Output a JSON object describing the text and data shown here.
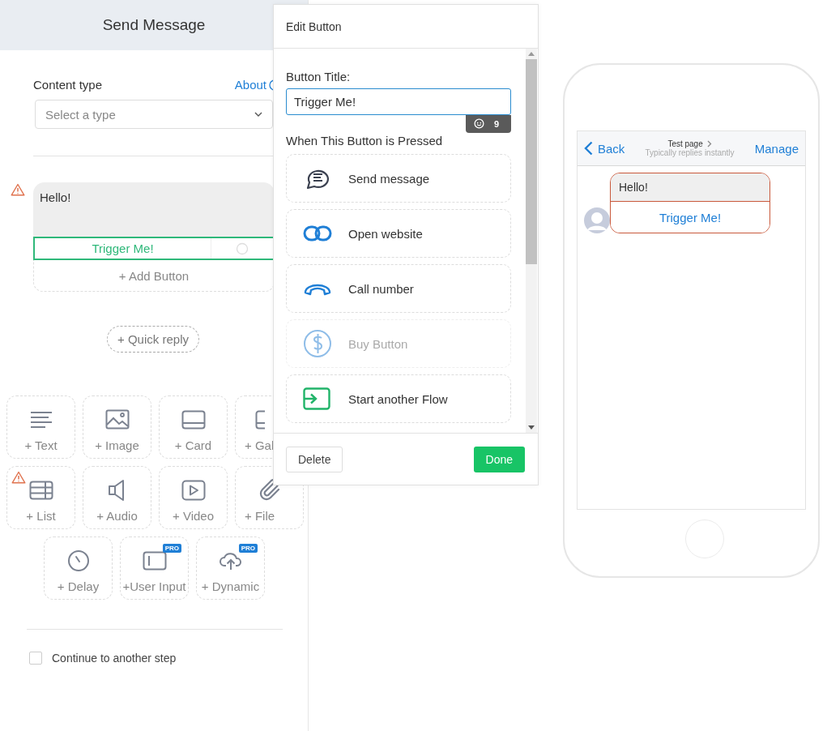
{
  "panel": {
    "title": "Send Message"
  },
  "content_type": {
    "label": "Content type",
    "about": "About",
    "placeholder": "Select a type"
  },
  "message": {
    "warning": true,
    "text": "Hello!",
    "buttons": [
      {
        "label": "Trigger Me!",
        "selected": true
      }
    ],
    "add_button": "+ Add Button"
  },
  "quick_reply": "+ Quick reply",
  "tile_rows": [
    [
      {
        "label": "+ Text",
        "kind": "text",
        "warning": false
      },
      {
        "label": "+ Image",
        "kind": "image",
        "warning": false
      },
      {
        "label": "+ Card",
        "kind": "card",
        "warning": false
      },
      {
        "label": "+ Gal",
        "kind": "gallery",
        "warning": false
      }
    ],
    [
      {
        "label": "+ List",
        "kind": "list",
        "warning": true
      },
      {
        "label": "+ Audio",
        "kind": "audio",
        "warning": false
      },
      {
        "label": "+ Video",
        "kind": "video",
        "warning": false
      },
      {
        "label": "+ File",
        "kind": "file",
        "warning": false
      }
    ],
    [
      {
        "label": "+ Delay",
        "kind": "delay",
        "warning": false
      },
      {
        "label": "+User Input",
        "kind": "input",
        "warning": false,
        "badge": "PRO"
      },
      {
        "label": "+ Dynamic",
        "kind": "cloud",
        "warning": false,
        "badge": "PRO"
      }
    ]
  ],
  "continue": {
    "label": "Continue to another step",
    "checked": false
  },
  "dialog": {
    "title": "Edit Button",
    "field_label": "Button Title:",
    "value": "Trigger Me!",
    "counter": "9",
    "section": "When This Button is Pressed",
    "actions": [
      {
        "label": "Send message",
        "kind": "message",
        "disabled": false
      },
      {
        "label": "Open website",
        "kind": "link",
        "disabled": false
      },
      {
        "label": "Call number",
        "kind": "phone",
        "disabled": false
      },
      {
        "label": "Buy Button",
        "kind": "dollar",
        "disabled": true
      },
      {
        "label": "Start another Flow",
        "kind": "flow",
        "disabled": false
      }
    ],
    "delete": "Delete",
    "done": "Done"
  },
  "preview": {
    "back": "Back",
    "page": "Test page",
    "status": "Typically replies instantly",
    "manage": "Manage",
    "message": "Hello!",
    "button": "Trigger Me!"
  }
}
